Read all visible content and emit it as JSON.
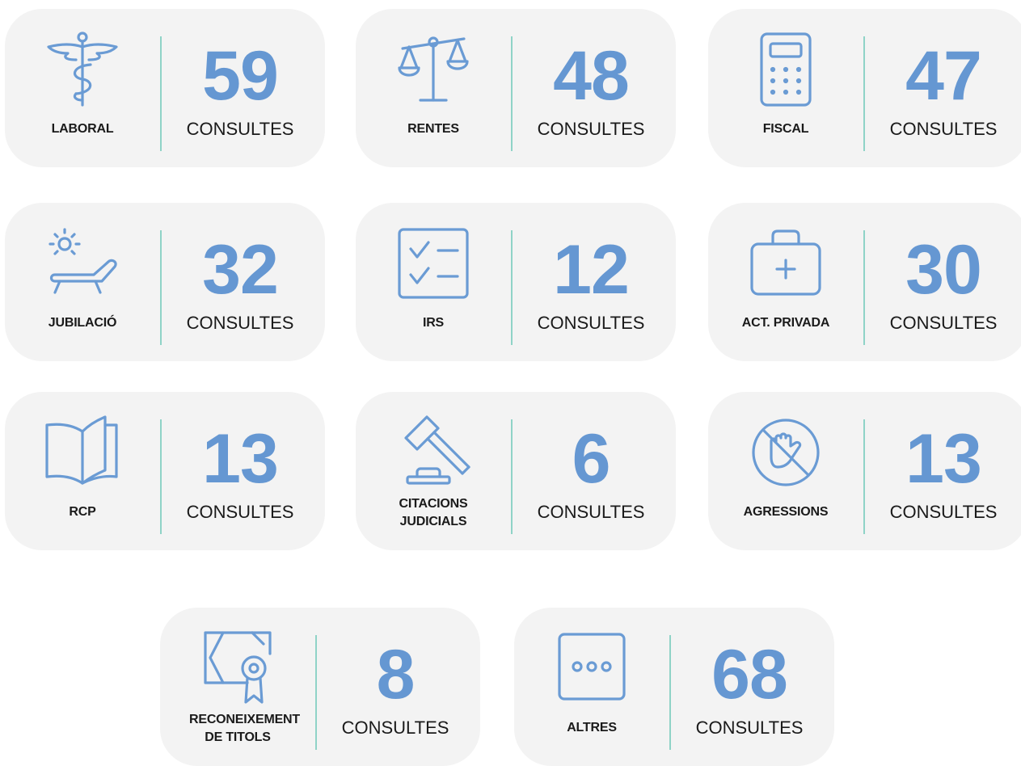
{
  "accent_color": "#6597d2",
  "divider_color": "#8fd3c7",
  "card_color": "#f3f3f3",
  "categories": [
    {
      "label": "LABORAL",
      "count": "59",
      "unit": "CONSULTES",
      "icon": "caduceus-icon"
    },
    {
      "label": "RENTES",
      "count": "48",
      "unit": "CONSULTES",
      "icon": "scales-icon"
    },
    {
      "label": "FISCAL",
      "count": "47",
      "unit": "CONSULTES",
      "icon": "calculator-icon"
    },
    {
      "label": "JUBILACIÓ",
      "count": "32",
      "unit": "CONSULTES",
      "icon": "sun-lounger-icon"
    },
    {
      "label": "IRS",
      "count": "12",
      "unit": "CONSULTES",
      "icon": "checklist-icon"
    },
    {
      "label": "ACT. PRIVADA",
      "count": "30",
      "unit": "CONSULTES",
      "icon": "medical-kit-icon"
    },
    {
      "label": "RCP",
      "count": "13",
      "unit": "CONSULTES",
      "icon": "open-book-icon"
    },
    {
      "label": "CITACIONS JUDICIALS",
      "count": "6",
      "unit": "CONSULTES",
      "icon": "gavel-icon"
    },
    {
      "label": "AGRESSIONS",
      "count": "13",
      "unit": "CONSULTES",
      "icon": "stop-fist-icon"
    },
    {
      "label": "RECONEIXEMENT DE TITOLS",
      "count": "8",
      "unit": "CONSULTES",
      "icon": "certificate-icon"
    },
    {
      "label": "ALTRES",
      "count": "68",
      "unit": "CONSULTES",
      "icon": "more-dots-icon"
    }
  ]
}
